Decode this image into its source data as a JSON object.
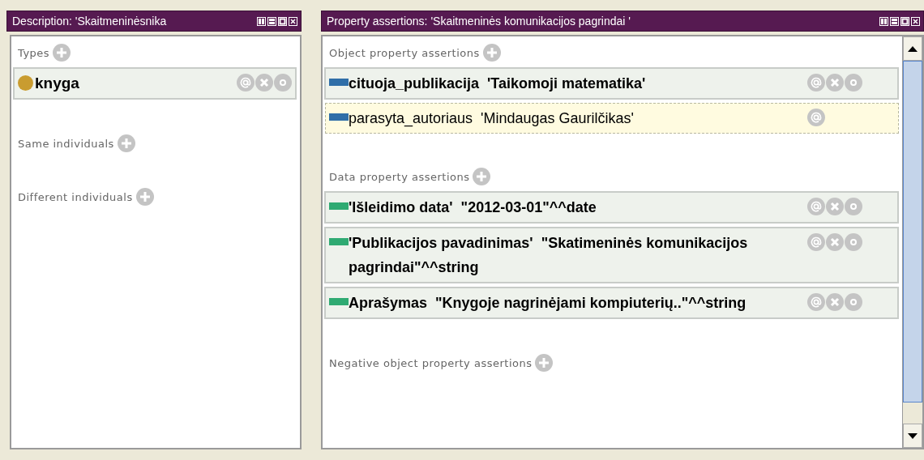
{
  "description_panel": {
    "title": "Description: 'Skaitmeninėsnika",
    "sections": [
      {
        "label": "Types",
        "rows": [
          {
            "kind": "class",
            "text": "knyga",
            "selected": false,
            "editable": true
          }
        ]
      },
      {
        "label": "Same individuals"
      },
      {
        "label": "Different individuals"
      }
    ]
  },
  "assertions_panel": {
    "title": "Property assertions: 'Skaitmeninės komunikacijos pagrindai '",
    "sections": [
      {
        "label": "Object property assertions",
        "rows": [
          {
            "kind": "object",
            "text": "cituoja_publikacija  'Taikomoji matematika'",
            "selected": false,
            "editable": true
          },
          {
            "kind": "object",
            "text": "parasyta_autoriaus  'Mindaugas Gaurilčikas'",
            "selected": true,
            "editable": false
          }
        ]
      },
      {
        "label": "Data property assertions",
        "rows": [
          {
            "kind": "data",
            "text": "'Išleidimo data'  \"2012-03-01\"^^date",
            "selected": false,
            "editable": true
          },
          {
            "kind": "data",
            "text": "'Publikacijos pavadinimas'  \"Skatimeninės komunikacijos pagrindai\"^^string",
            "selected": false,
            "editable": true
          },
          {
            "kind": "data",
            "text": "Aprašymas  \"Knygoje nagrinėjami kompiuterių..\"^^string",
            "selected": false,
            "editable": true
          }
        ]
      },
      {
        "label": "Negative object property assertions"
      }
    ]
  }
}
